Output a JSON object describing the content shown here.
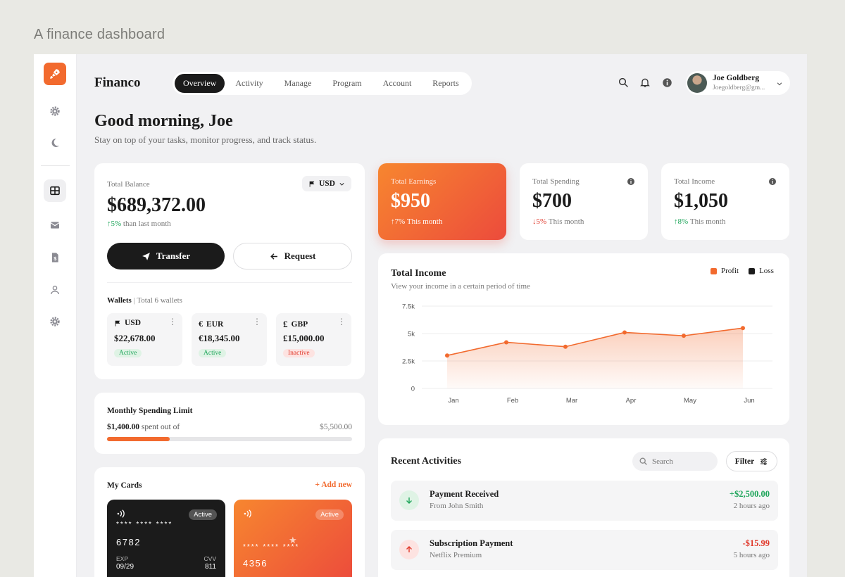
{
  "caption": "A finance dashboard",
  "brand": "Financo",
  "nav": [
    {
      "label": "Overview",
      "active": true
    },
    {
      "label": "Activity",
      "active": false
    },
    {
      "label": "Manage",
      "active": false
    },
    {
      "label": "Program",
      "active": false
    },
    {
      "label": "Account",
      "active": false
    },
    {
      "label": "Reports",
      "active": false
    }
  ],
  "profile": {
    "name": "Joe Goldberg",
    "email": "Joegoldberg@gm..."
  },
  "greeting": {
    "title": "Good morning, Joe",
    "subtitle": "Stay on top of your tasks, monitor progress, and track status."
  },
  "balance": {
    "label": "Total Balance",
    "currency": "USD",
    "amount": "$689,372.00",
    "change": "5%",
    "change_text": "than last month",
    "transfer_label": "Transfer",
    "request_label": "Request"
  },
  "wallets": {
    "title": "Wallets",
    "count_text": "Total 6 wallets",
    "items": [
      {
        "currency": "USD",
        "amount": "$22,678.00",
        "status": "Active"
      },
      {
        "currency": "EUR",
        "amount": "€18,345.00",
        "status": "Active"
      },
      {
        "currency": "GBP",
        "amount": "£15,000.00",
        "status": "Inactive"
      }
    ]
  },
  "spending_limit": {
    "title": "Monthly Spending Limit",
    "spent": "$1,400.00",
    "spent_text": "spent out of",
    "limit": "$5,500.00",
    "progress": 0.255
  },
  "my_cards": {
    "title": "My Cards",
    "add_label": "Add new",
    "cards": [
      {
        "status": "Active",
        "masked": "**** **** ****",
        "last4": "6782",
        "exp_label": "EXP",
        "exp": "09/29",
        "cvv_label": "CVV",
        "cvv": "811",
        "theme": "dark"
      },
      {
        "status": "Active",
        "masked": "**** **** ****",
        "last4": "4356",
        "theme": "orange"
      }
    ]
  },
  "stats": [
    {
      "label": "Total Earnings",
      "value": "$950",
      "change": "7%",
      "change_text": "This month",
      "direction": "up",
      "highlight": true
    },
    {
      "label": "Total Spending",
      "value": "$700",
      "change": "5%",
      "change_text": "This month",
      "direction": "down",
      "highlight": false
    },
    {
      "label": "Total Income",
      "value": "$1,050",
      "change": "8%",
      "change_text": "This month",
      "direction": "up",
      "highlight": false
    }
  ],
  "income_chart": {
    "title": "Total Income",
    "subtitle": "View your income in a certain period of time",
    "legend": [
      {
        "name": "Profit",
        "color": "#f26a2e"
      },
      {
        "name": "Loss",
        "color": "#1b1b1b"
      }
    ]
  },
  "chart_data": {
    "type": "area",
    "categories": [
      "Jan",
      "Feb",
      "Mar",
      "Apr",
      "May",
      "Jun"
    ],
    "series": [
      {
        "name": "Profit",
        "values": [
          3000,
          4200,
          3800,
          5100,
          4800,
          5500
        ]
      }
    ],
    "yticks": [
      "0",
      "2.5k",
      "5k",
      "7.5k"
    ],
    "ylim": [
      0,
      7500
    ],
    "grid": true,
    "legend_position": "top-right",
    "color": "#f26a2e"
  },
  "activities": {
    "title": "Recent Activities",
    "search_placeholder": "Search",
    "filter_label": "Filter",
    "items": [
      {
        "title": "Payment Received",
        "subtitle": "From John Smith",
        "amount": "+$2,500.00",
        "time": "2 hours ago",
        "direction": "in"
      },
      {
        "title": "Subscription Payment",
        "subtitle": "Netflix Premium",
        "amount": "-$15.99",
        "time": "5 hours ago",
        "direction": "out"
      }
    ]
  }
}
